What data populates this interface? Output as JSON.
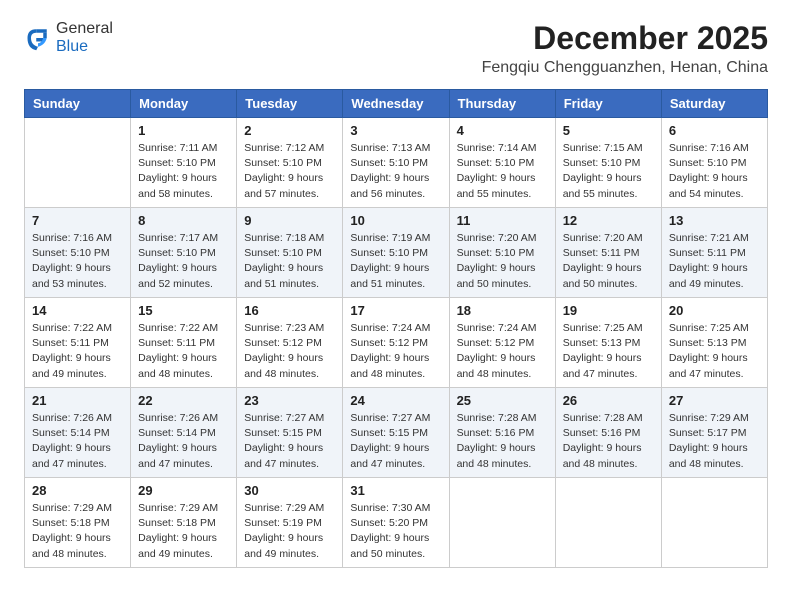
{
  "header": {
    "logo_line1": "General",
    "logo_line2": "Blue",
    "title": "December 2025",
    "subtitle": "Fengqiu Chengguanzhen, Henan, China"
  },
  "weekdays": [
    "Sunday",
    "Monday",
    "Tuesday",
    "Wednesday",
    "Thursday",
    "Friday",
    "Saturday"
  ],
  "weeks": [
    [
      {
        "day": "",
        "sunrise": "",
        "sunset": "",
        "daylight": ""
      },
      {
        "day": "1",
        "sunrise": "Sunrise: 7:11 AM",
        "sunset": "Sunset: 5:10 PM",
        "daylight": "Daylight: 9 hours and 58 minutes."
      },
      {
        "day": "2",
        "sunrise": "Sunrise: 7:12 AM",
        "sunset": "Sunset: 5:10 PM",
        "daylight": "Daylight: 9 hours and 57 minutes."
      },
      {
        "day": "3",
        "sunrise": "Sunrise: 7:13 AM",
        "sunset": "Sunset: 5:10 PM",
        "daylight": "Daylight: 9 hours and 56 minutes."
      },
      {
        "day": "4",
        "sunrise": "Sunrise: 7:14 AM",
        "sunset": "Sunset: 5:10 PM",
        "daylight": "Daylight: 9 hours and 55 minutes."
      },
      {
        "day": "5",
        "sunrise": "Sunrise: 7:15 AM",
        "sunset": "Sunset: 5:10 PM",
        "daylight": "Daylight: 9 hours and 55 minutes."
      },
      {
        "day": "6",
        "sunrise": "Sunrise: 7:16 AM",
        "sunset": "Sunset: 5:10 PM",
        "daylight": "Daylight: 9 hours and 54 minutes."
      }
    ],
    [
      {
        "day": "7",
        "sunrise": "Sunrise: 7:16 AM",
        "sunset": "Sunset: 5:10 PM",
        "daylight": "Daylight: 9 hours and 53 minutes."
      },
      {
        "day": "8",
        "sunrise": "Sunrise: 7:17 AM",
        "sunset": "Sunset: 5:10 PM",
        "daylight": "Daylight: 9 hours and 52 minutes."
      },
      {
        "day": "9",
        "sunrise": "Sunrise: 7:18 AM",
        "sunset": "Sunset: 5:10 PM",
        "daylight": "Daylight: 9 hours and 51 minutes."
      },
      {
        "day": "10",
        "sunrise": "Sunrise: 7:19 AM",
        "sunset": "Sunset: 5:10 PM",
        "daylight": "Daylight: 9 hours and 51 minutes."
      },
      {
        "day": "11",
        "sunrise": "Sunrise: 7:20 AM",
        "sunset": "Sunset: 5:10 PM",
        "daylight": "Daylight: 9 hours and 50 minutes."
      },
      {
        "day": "12",
        "sunrise": "Sunrise: 7:20 AM",
        "sunset": "Sunset: 5:11 PM",
        "daylight": "Daylight: 9 hours and 50 minutes."
      },
      {
        "day": "13",
        "sunrise": "Sunrise: 7:21 AM",
        "sunset": "Sunset: 5:11 PM",
        "daylight": "Daylight: 9 hours and 49 minutes."
      }
    ],
    [
      {
        "day": "14",
        "sunrise": "Sunrise: 7:22 AM",
        "sunset": "Sunset: 5:11 PM",
        "daylight": "Daylight: 9 hours and 49 minutes."
      },
      {
        "day": "15",
        "sunrise": "Sunrise: 7:22 AM",
        "sunset": "Sunset: 5:11 PM",
        "daylight": "Daylight: 9 hours and 48 minutes."
      },
      {
        "day": "16",
        "sunrise": "Sunrise: 7:23 AM",
        "sunset": "Sunset: 5:12 PM",
        "daylight": "Daylight: 9 hours and 48 minutes."
      },
      {
        "day": "17",
        "sunrise": "Sunrise: 7:24 AM",
        "sunset": "Sunset: 5:12 PM",
        "daylight": "Daylight: 9 hours and 48 minutes."
      },
      {
        "day": "18",
        "sunrise": "Sunrise: 7:24 AM",
        "sunset": "Sunset: 5:12 PM",
        "daylight": "Daylight: 9 hours and 48 minutes."
      },
      {
        "day": "19",
        "sunrise": "Sunrise: 7:25 AM",
        "sunset": "Sunset: 5:13 PM",
        "daylight": "Daylight: 9 hours and 47 minutes."
      },
      {
        "day": "20",
        "sunrise": "Sunrise: 7:25 AM",
        "sunset": "Sunset: 5:13 PM",
        "daylight": "Daylight: 9 hours and 47 minutes."
      }
    ],
    [
      {
        "day": "21",
        "sunrise": "Sunrise: 7:26 AM",
        "sunset": "Sunset: 5:14 PM",
        "daylight": "Daylight: 9 hours and 47 minutes."
      },
      {
        "day": "22",
        "sunrise": "Sunrise: 7:26 AM",
        "sunset": "Sunset: 5:14 PM",
        "daylight": "Daylight: 9 hours and 47 minutes."
      },
      {
        "day": "23",
        "sunrise": "Sunrise: 7:27 AM",
        "sunset": "Sunset: 5:15 PM",
        "daylight": "Daylight: 9 hours and 47 minutes."
      },
      {
        "day": "24",
        "sunrise": "Sunrise: 7:27 AM",
        "sunset": "Sunset: 5:15 PM",
        "daylight": "Daylight: 9 hours and 47 minutes."
      },
      {
        "day": "25",
        "sunrise": "Sunrise: 7:28 AM",
        "sunset": "Sunset: 5:16 PM",
        "daylight": "Daylight: 9 hours and 48 minutes."
      },
      {
        "day": "26",
        "sunrise": "Sunrise: 7:28 AM",
        "sunset": "Sunset: 5:16 PM",
        "daylight": "Daylight: 9 hours and 48 minutes."
      },
      {
        "day": "27",
        "sunrise": "Sunrise: 7:29 AM",
        "sunset": "Sunset: 5:17 PM",
        "daylight": "Daylight: 9 hours and 48 minutes."
      }
    ],
    [
      {
        "day": "28",
        "sunrise": "Sunrise: 7:29 AM",
        "sunset": "Sunset: 5:18 PM",
        "daylight": "Daylight: 9 hours and 48 minutes."
      },
      {
        "day": "29",
        "sunrise": "Sunrise: 7:29 AM",
        "sunset": "Sunset: 5:18 PM",
        "daylight": "Daylight: 9 hours and 49 minutes."
      },
      {
        "day": "30",
        "sunrise": "Sunrise: 7:29 AM",
        "sunset": "Sunset: 5:19 PM",
        "daylight": "Daylight: 9 hours and 49 minutes."
      },
      {
        "day": "31",
        "sunrise": "Sunrise: 7:30 AM",
        "sunset": "Sunset: 5:20 PM",
        "daylight": "Daylight: 9 hours and 50 minutes."
      },
      {
        "day": "",
        "sunrise": "",
        "sunset": "",
        "daylight": ""
      },
      {
        "day": "",
        "sunrise": "",
        "sunset": "",
        "daylight": ""
      },
      {
        "day": "",
        "sunrise": "",
        "sunset": "",
        "daylight": ""
      }
    ]
  ]
}
